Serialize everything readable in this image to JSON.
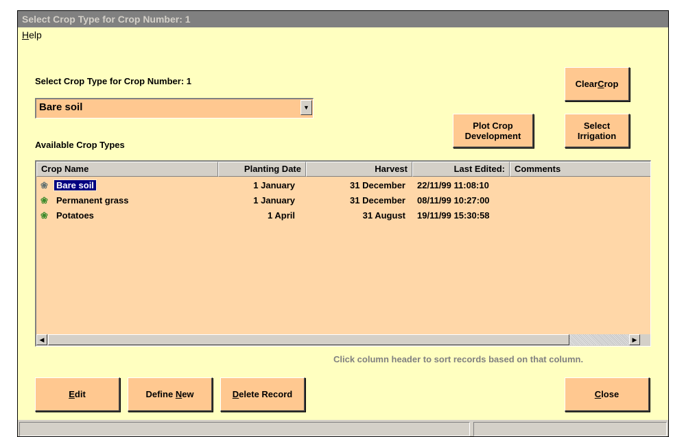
{
  "window": {
    "title": "Select Crop Type for Crop Number: 1"
  },
  "menu": {
    "help": "Help",
    "help_mnemonic": "H",
    "help_rest": "elp"
  },
  "labels": {
    "select_crop": "Select Crop Type for Crop Number: 1",
    "available": "Available Crop Types",
    "hint": "Click column header to sort records based on that column."
  },
  "combo": {
    "value": "Bare soil"
  },
  "buttons": {
    "clear_crop_pre": "Clear ",
    "clear_crop_key": "C",
    "clear_crop_post": "rop",
    "plot_crop_line1": "Plot Crop",
    "plot_crop_line2": "Development",
    "select_irr_line1": "Select",
    "select_irr_line2": "Irrigation",
    "edit_key": "E",
    "edit_post": "dit",
    "define_pre": "Define ",
    "define_key": "N",
    "define_post": "ew",
    "delete_key": "D",
    "delete_post": "elete Record",
    "close_key": "C",
    "close_post": "lose"
  },
  "table": {
    "columns": [
      "Crop Name",
      "Planting Date",
      "Harvest",
      "Last Edited:",
      "Comments"
    ],
    "rows": [
      {
        "name": "Bare soil",
        "planting": "1 January",
        "harvest": "31 December",
        "edited": "22/11/99 11:08:10",
        "comments": ""
      },
      {
        "name": "Permanent grass",
        "planting": "1 January",
        "harvest": "31 December",
        "edited": "08/11/99 10:27:00",
        "comments": ""
      },
      {
        "name": "Potatoes",
        "planting": "1 April",
        "harvest": "31 August",
        "edited": "19/11/99 15:30:58",
        "comments": ""
      }
    ],
    "selected_row": 0
  },
  "icons": {
    "row_icon": "plant-icon",
    "combo_arrow": "chevron-down-icon",
    "scroll_left": "arrow-left-icon",
    "scroll_right": "arrow-right-icon"
  },
  "colors": {
    "background": "#ffffc0",
    "button": "#ffc890",
    "grid": "#ffd7a8",
    "selection": "#000080"
  }
}
